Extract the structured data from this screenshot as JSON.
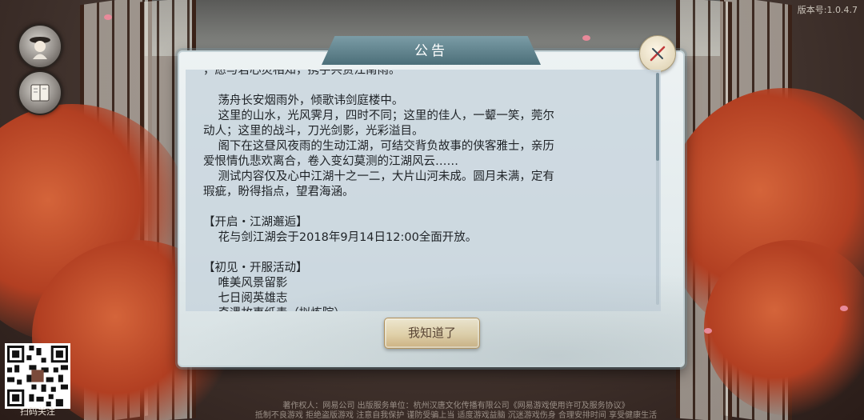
{
  "app": {
    "version": "版本号:1.0.4.7"
  },
  "dialog": {
    "title": "公告",
    "lines": [
      "，愿与君心灵相知，携手共赏江南雨。",
      "",
      "    荡舟长安烟雨外，倾歌讳剑庭楼中。",
      "    这里的山水，光风霁月，四时不同；这里的佳人，一颦一笑，莞尔",
      "动人；这里的战斗，刀光剑影，光彩溢目。",
      "    阁下在这昼风夜雨的生动江湖，可结交背负故事的侠客雅士，亲历",
      "爱恨情仇悲欢离合，卷入变幻莫测的江湖风云……",
      "    测试内容仅及心中江湖十之一二，大片山河未成。圆月未满，定有",
      "瑕疵，盼得指点，望君海涵。",
      "",
      "【开启・江湖邂逅】",
      "    花与剑江湖会于2018年9月14日12:00全面开放。",
      "",
      "【初见・开服活动】",
      "    唯美风景留影",
      "    七日阅英雄志",
      "    奇遇故事纸毒（拟炼院）"
    ],
    "ok_label": "我知道了"
  },
  "side_buttons": [
    {
      "icon": "character-icon"
    },
    {
      "icon": "book-icon"
    }
  ],
  "qr": {
    "label": "扫码关注"
  },
  "footer": {
    "line1": "著作权人：网易公司    出版服务单位：杭州汉唐文化传播有限公司《网易游戏使用许可及服务协议》",
    "line2": "抵制不良游戏 拒绝盗版游戏 注意自我保护 谨防受骗上当 适度游戏益脑 沉迷游戏伤身 合理安排时间 享受健康生活"
  },
  "colors": {
    "dialog_bg": "#e3ebed",
    "title_tab": "#4c6f79",
    "button_gold": "#efd9a8",
    "maple": "#b23f22"
  }
}
